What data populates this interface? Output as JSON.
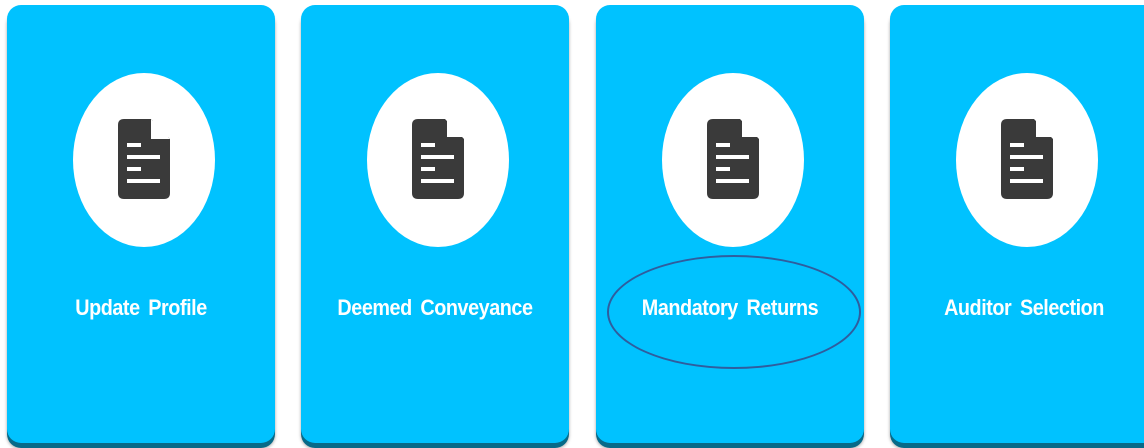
{
  "tiles": [
    {
      "label": "Update Profile",
      "icon": "document-icon"
    },
    {
      "label": "Deemed Conveyance",
      "icon": "document-icon"
    },
    {
      "label": "Mandatory Returns",
      "icon": "document-icon",
      "highlighted": true
    },
    {
      "label": "Auditor Selection",
      "icon": "document-icon"
    }
  ],
  "colors": {
    "tile_background": "#00c2ff",
    "tile_shadow": "#086a88",
    "icon_circle": "#ffffff",
    "icon_fill": "#3a3a3a",
    "label_text": "#ffffff",
    "highlight_outline": "#2f5d9e"
  }
}
